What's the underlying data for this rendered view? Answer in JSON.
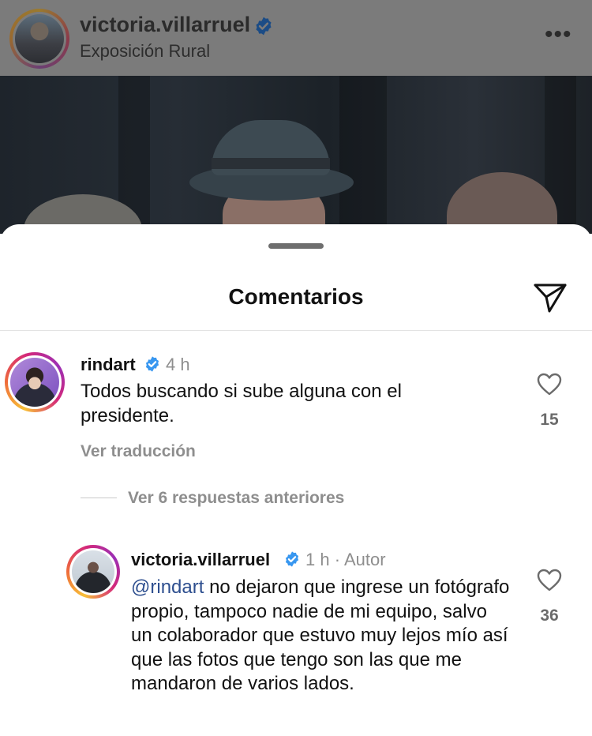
{
  "post": {
    "username": "victoria.villarruel",
    "location": "Exposición Rural",
    "more_icon": "more-horizontal-icon"
  },
  "comments_sheet": {
    "title": "Comentarios",
    "share_icon": "paper-plane-icon",
    "comments": [
      {
        "username": "rindart",
        "verified": true,
        "time": "4 h",
        "text": "Todos buscando si sube alguna con el presidente.",
        "translate_label": "Ver traducción",
        "likes": "15"
      }
    ],
    "view_replies_label": "Ver 6 respuestas anteriores",
    "reply": {
      "username": "victoria.villarruel",
      "verified": true,
      "time": "1 h",
      "author_label": "Autor",
      "mention": "@rindart",
      "text": "no dejaron que ingrese un fotógrafo propio, tampoco nadie de mi equipo, salvo un colaborador que estuvo muy lejos mío así que las fotos que tengo son las que me mandaron de varios lados.",
      "likes": "36"
    }
  },
  "colors": {
    "verified_blue": "#3897f0",
    "mention_blue": "#2e4f8f",
    "muted_text": "#8e8e8e",
    "overlay_gray": "#7b7b7b"
  }
}
